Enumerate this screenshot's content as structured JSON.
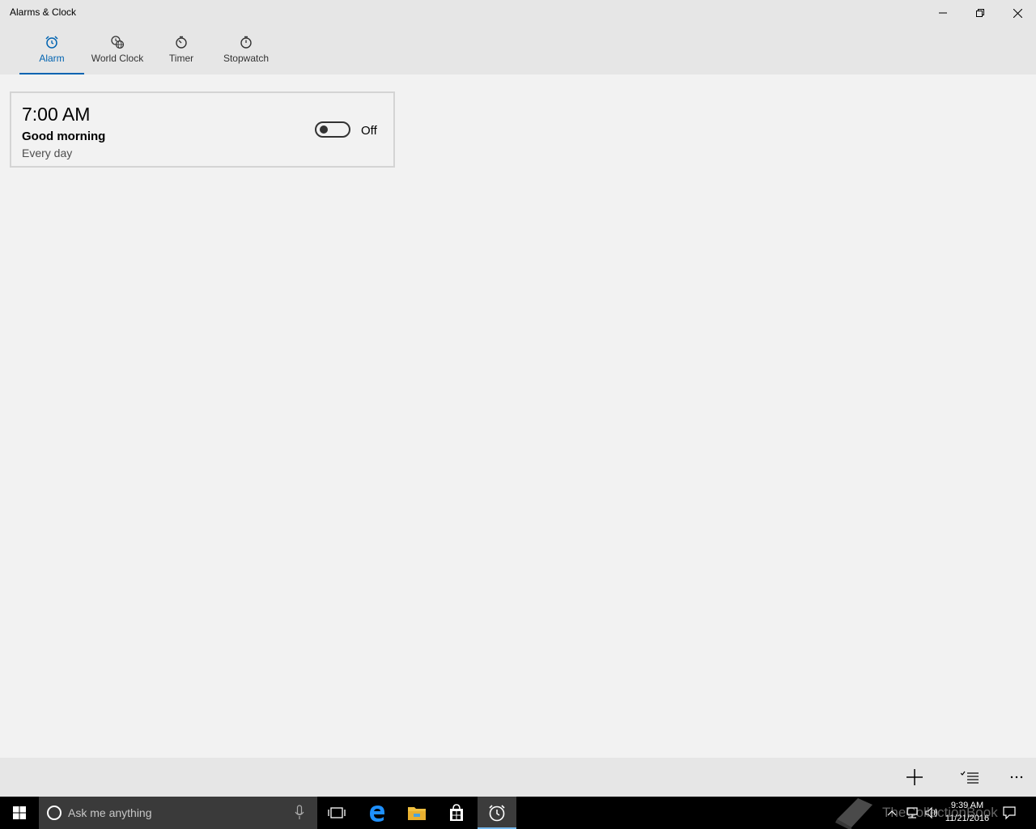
{
  "window": {
    "title": "Alarms & Clock",
    "controls": {
      "minimize": "minimize-icon",
      "restore": "restore-icon",
      "close": "close-icon"
    }
  },
  "tabs": [
    {
      "label": "Alarm",
      "icon": "alarm-clock-icon",
      "active": true
    },
    {
      "label": "World Clock",
      "icon": "globe-clock-icon",
      "active": false
    },
    {
      "label": "Timer",
      "icon": "timer-icon",
      "active": false
    },
    {
      "label": "Stopwatch",
      "icon": "stopwatch-icon",
      "active": false
    }
  ],
  "alarms": [
    {
      "time": "7:00 AM",
      "name": "Good morning",
      "repeat": "Every day",
      "enabled": false,
      "state_label": "Off"
    }
  ],
  "commandbar": {
    "add_icon": "plus-icon",
    "select_icon": "select-list-icon",
    "more_icon": "more-ellipsis-icon"
  },
  "taskbar": {
    "search_placeholder": "Ask me anything",
    "clock_time": "9:39 AM",
    "clock_date": "11/21/2016",
    "watermark": "TheCollectionBook",
    "apps": [
      "task-view-icon",
      "edge-icon",
      "file-explorer-icon",
      "store-icon",
      "alarms-app-icon"
    ]
  },
  "colors": {
    "accent": "#0063b1",
    "chrome": "#e6e6e6",
    "content_bg": "#f2f2f2",
    "taskbar": "#000000"
  }
}
